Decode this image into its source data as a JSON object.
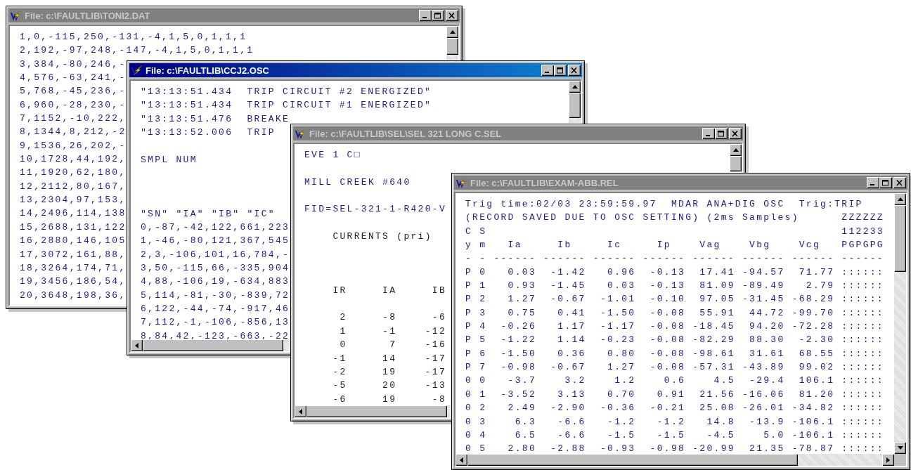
{
  "windows": [
    {
      "title": "File: c:\\FAULTLIB\\TONI2.DAT",
      "active": false,
      "horizontal_scrollbar": false,
      "lines": [
        {
          "text": "1,0,-115,250,-131,-4,1,5,0,1,1,1"
        },
        {
          "text": "2,192,-97,248,-147,-4,1,5,0,1,1,1"
        },
        {
          "text": "3,384,-80,246,-"
        },
        {
          "text": "4,576,-63,241,-"
        },
        {
          "text": "5,768,-45,236,-"
        },
        {
          "text": "6,960,-28,230,-"
        },
        {
          "text": "7,1152,-10,222,"
        },
        {
          "text": "8,1344,8,212,-2"
        },
        {
          "text": "9,1536,26,202,-"
        },
        {
          "text": "10,1728,44,192,"
        },
        {
          "text": "11,1920,62,180,"
        },
        {
          "text": "12,2112,80,167,"
        },
        {
          "text": "13,2304,97,153,"
        },
        {
          "text": "14,2496,114,138"
        },
        {
          "text": "15,2688,131,122"
        },
        {
          "text": "16,2880,146,105"
        },
        {
          "text": "17,3072,161,88,"
        },
        {
          "text": "18,3264,174,71,"
        },
        {
          "text": "19,3456,186,54,"
        },
        {
          "text": "20,3648,198,36,"
        }
      ]
    },
    {
      "title": "File: c:\\FAULTLIB\\CCJ2.OSC",
      "active": true,
      "horizontal_scrollbar": true,
      "lines": [
        {
          "text": "\"13:13:51.434  TRIP CIRCUIT #2 ENERGIZED\""
        },
        {
          "text": "\"13:13:51.434  TRIP CIRCUIT #1 ENERGIZED\""
        },
        {
          "text": "\"13:13:51.476  BREAKE"
        },
        {
          "text": "\"13:13:52.006  TRIP"
        },
        {
          "text": "SMPL NUM"
        },
        {
          "text": "\"SN\" \"IA\" \"IB\" \"IC\""
        },
        {
          "text": "0,-87,-42,122,661,223"
        },
        {
          "text": "1,-46,-80,121,367,545"
        },
        {
          "text": "2,3,-106,101,16,784,-"
        },
        {
          "text": "3,50,-115,66,-335,904"
        },
        {
          "text": "4,88,-106,19,-634,883"
        },
        {
          "text": "5,114,-81,-30,-839,72"
        },
        {
          "text": "6,122,-44,-74,-917,46"
        },
        {
          "text": "7,112,-1,-106,-856,13"
        },
        {
          "text": "8,84,42,-123,-663,-22"
        }
      ]
    },
    {
      "title": "File: c:\\FAULTLIB\\SEL\\SEL 321 LONG C.SEL",
      "active": false,
      "horizontal_scrollbar": true,
      "lines": [
        {
          "text": "EVE 1 C□",
          "color": "#1c1c8c"
        },
        {
          "text": "MILL CREEK #640",
          "color": "#1c1c8c"
        },
        {
          "text": "FID=SEL-321-1-R420-V",
          "color": "#1c1c8c"
        },
        {
          "text": "    CURRENTS (pri)",
          "color": "#202020"
        },
        {
          "text": "    IR     IA     IB",
          "color": "#202020"
        },
        {
          "text": "     2     -8     -6",
          "color": "#202020"
        },
        {
          "text": "     1     -1    -12",
          "color": "#202020"
        },
        {
          "text": "     0      7    -16",
          "color": "#202020"
        },
        {
          "text": "    -1     14    -17",
          "color": "#202020"
        },
        {
          "text": "    -2     19    -17",
          "color": "#202020"
        },
        {
          "text": "    -5     20    -13",
          "color": "#202020"
        },
        {
          "text": "    -6     19     -8",
          "color": "#202020"
        }
      ]
    },
    {
      "title": "File: c:\\FAULTLIB\\EXAM-ABB.REL",
      "active": false,
      "horizontal_scrollbar": true,
      "lines": [
        {
          "text": "Trig time:02/03 23:59:59.97  MDAR ANA+DIG OSC  Trig:TRIP"
        },
        {
          "text": "(RECORD SAVED DUE TO OSC SETTING) (2ms Samples)      ZZZZZZ"
        },
        {
          "text": "C S                                                  112233"
        },
        {
          "text": "y m   Ia     Ib     Ic     Ip    Vag    Vbg    Vcg   PGPGPG"
        },
        {
          "text": "- - ------ ------ ------ ------ ------ ------ ------ ------"
        },
        {
          "text": "P 0   0.03  -1.42   0.96  -0.13  17.41 -94.57  71.77 ::::::"
        },
        {
          "text": "P 1   0.93  -1.45   0.03  -0.13  81.09 -89.49   2.79 ::::::"
        },
        {
          "text": "P 2   1.27  -0.67  -1.01  -0.10  97.05 -31.45 -68.29 ::::::"
        },
        {
          "text": "P 3   0.75   0.41  -1.50  -0.08  55.91  44.72 -99.70 ::::::"
        },
        {
          "text": "P 4  -0.26   1.17  -1.17  -0.08 -18.45  94.20 -72.28 ::::::"
        },
        {
          "text": "P 5  -1.22   1.14  -0.23  -0.08 -82.29  88.30  -2.30 ::::::"
        },
        {
          "text": "P 6  -1.50   0.36   0.80  -0.08 -98.61  31.61  68.55 ::::::"
        },
        {
          "text": "P 7  -0.98  -0.67   1.27  -0.08 -57.31 -43.89  99.02 ::::::"
        },
        {
          "text": "0 0   -3.7    3.2    1.2    0.6    4.5  -29.4  106.1 ::::::"
        },
        {
          "text": "0 1  -3.52   3.13   0.70   0.91  21.56 -16.06  81.20 ::::::"
        },
        {
          "text": "0 2   2.49  -2.90  -0.36  -0.21  25.08 -26.01 -34.82 ::::::"
        },
        {
          "text": "0 3    6.3   -6.6   -1.2   -1.2   14.8  -13.9 -106.1 ::::::"
        },
        {
          "text": "0 4    6.5   -6.6   -1.5   -1.5   -4.5    5.0 -106.1 ::::::"
        },
        {
          "text": "0 5   2.80  -2.88  -0.93  -0.98 -20.99  21.35 -78.87 ::::::"
        }
      ]
    }
  ]
}
